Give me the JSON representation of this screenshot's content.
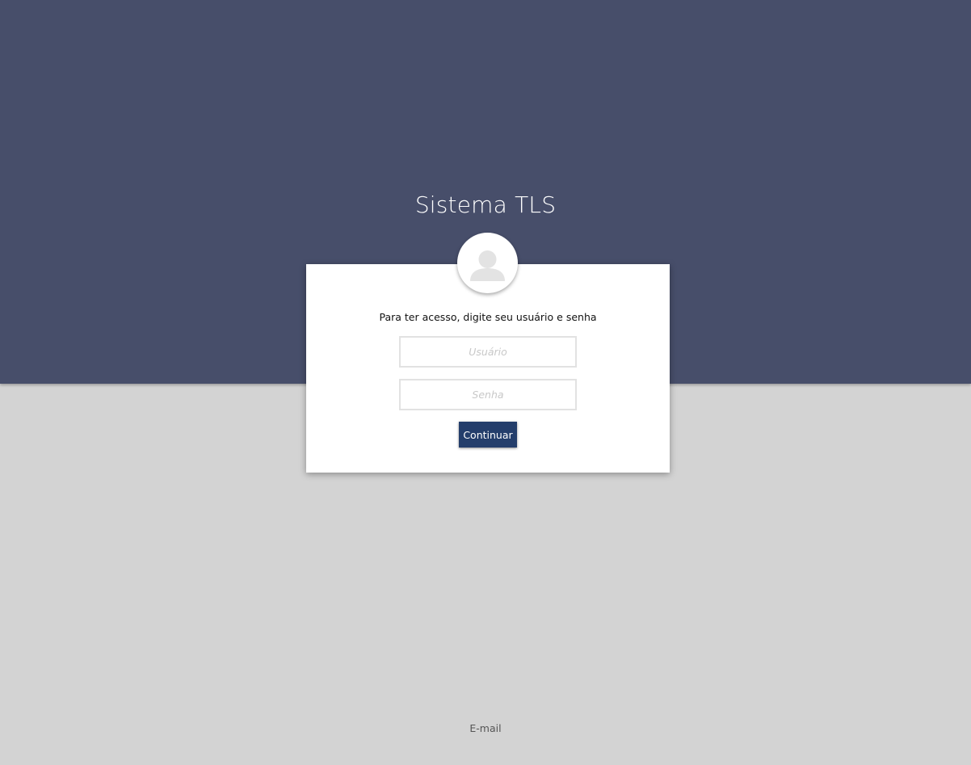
{
  "header": {
    "title": "Sistema TLS",
    "background_color": "#474e6a"
  },
  "login": {
    "avatar_icon": "user-silhouette-icon",
    "instructions": "Para ter acesso, digite seu usuário e senha",
    "username": {
      "placeholder": "Usuário",
      "value": ""
    },
    "password": {
      "placeholder": "Senha",
      "value": ""
    },
    "submit_label": "Continuar",
    "submit_color": "#243e6b"
  },
  "footer": {
    "email_link": "E-mail"
  }
}
